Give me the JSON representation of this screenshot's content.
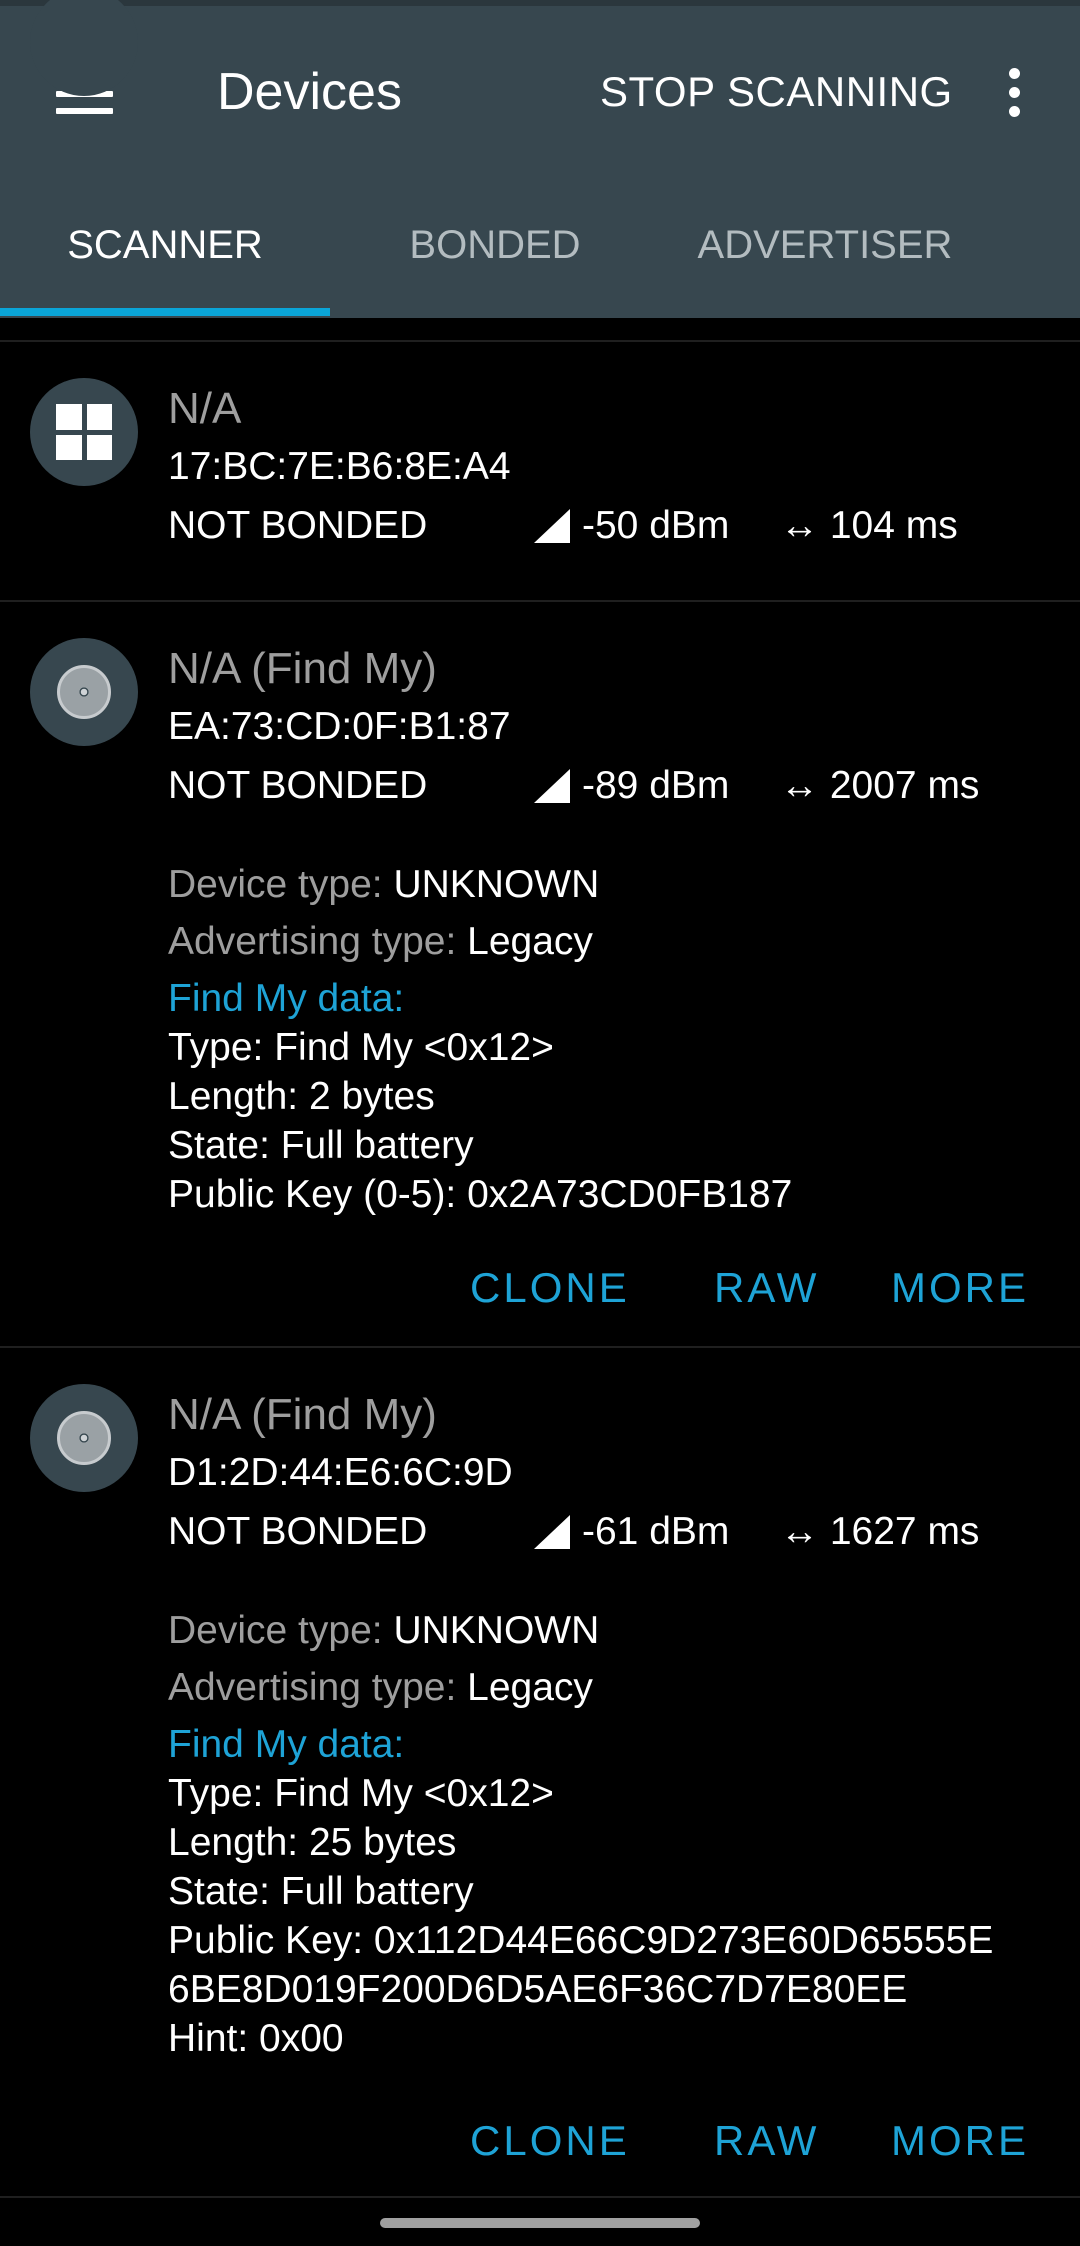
{
  "toolbar": {
    "title": "Devices",
    "stop_label": "STOP SCANNING"
  },
  "tabs": [
    {
      "label": "SCANNER",
      "active": true
    },
    {
      "label": "BONDED",
      "active": false
    },
    {
      "label": "ADVERTISER",
      "active": false
    }
  ],
  "colors": {
    "toolbar": "#37474f",
    "accent": "#1ea3d6",
    "background": "#000000",
    "muted_text": "#9e9e9e"
  },
  "devices": [
    {
      "icon": "windows-icon",
      "name": "N/A",
      "address": "17:BC:7E:B6:8E:A4",
      "bond_state": "NOT BONDED",
      "rssi": "-50 dBm",
      "interval": "104 ms"
    },
    {
      "icon": "disc-icon",
      "name": "N/A  (Find My)",
      "address": "EA:73:CD:0F:B1:87",
      "bond_state": "NOT BONDED",
      "rssi": "-89 dBm",
      "interval": "2007 ms",
      "device_type_label": "Device type: ",
      "device_type": "UNKNOWN",
      "adv_type_label": "Advertising type: ",
      "adv_type": "Legacy",
      "data_header": "Find My data:",
      "data_lines": [
        "Type: Find My <0x12>",
        "Length: 2 bytes",
        "State: Full battery",
        "Public Key (0-5): 0x2A73CD0FB187"
      ],
      "actions": [
        "CLONE",
        "RAW",
        "MORE"
      ]
    },
    {
      "icon": "disc-icon",
      "name": "N/A  (Find My)",
      "address": "D1:2D:44:E6:6C:9D",
      "bond_state": "NOT BONDED",
      "rssi": "-61 dBm",
      "interval": "1627 ms",
      "device_type_label": "Device type: ",
      "device_type": "UNKNOWN",
      "adv_type_label": "Advertising type: ",
      "adv_type": "Legacy",
      "data_header": "Find My data:",
      "data_lines": [
        "Type: Find My <0x12>",
        "Length: 25 bytes",
        "State: Full battery",
        "Public Key: 0x112D44E66C9D273E60D65555E",
        "6BE8D019F200D6D5AE6F36C7D7E80EE",
        "Hint: 0x00"
      ],
      "actions": [
        "CLONE",
        "RAW",
        "MORE"
      ]
    }
  ]
}
